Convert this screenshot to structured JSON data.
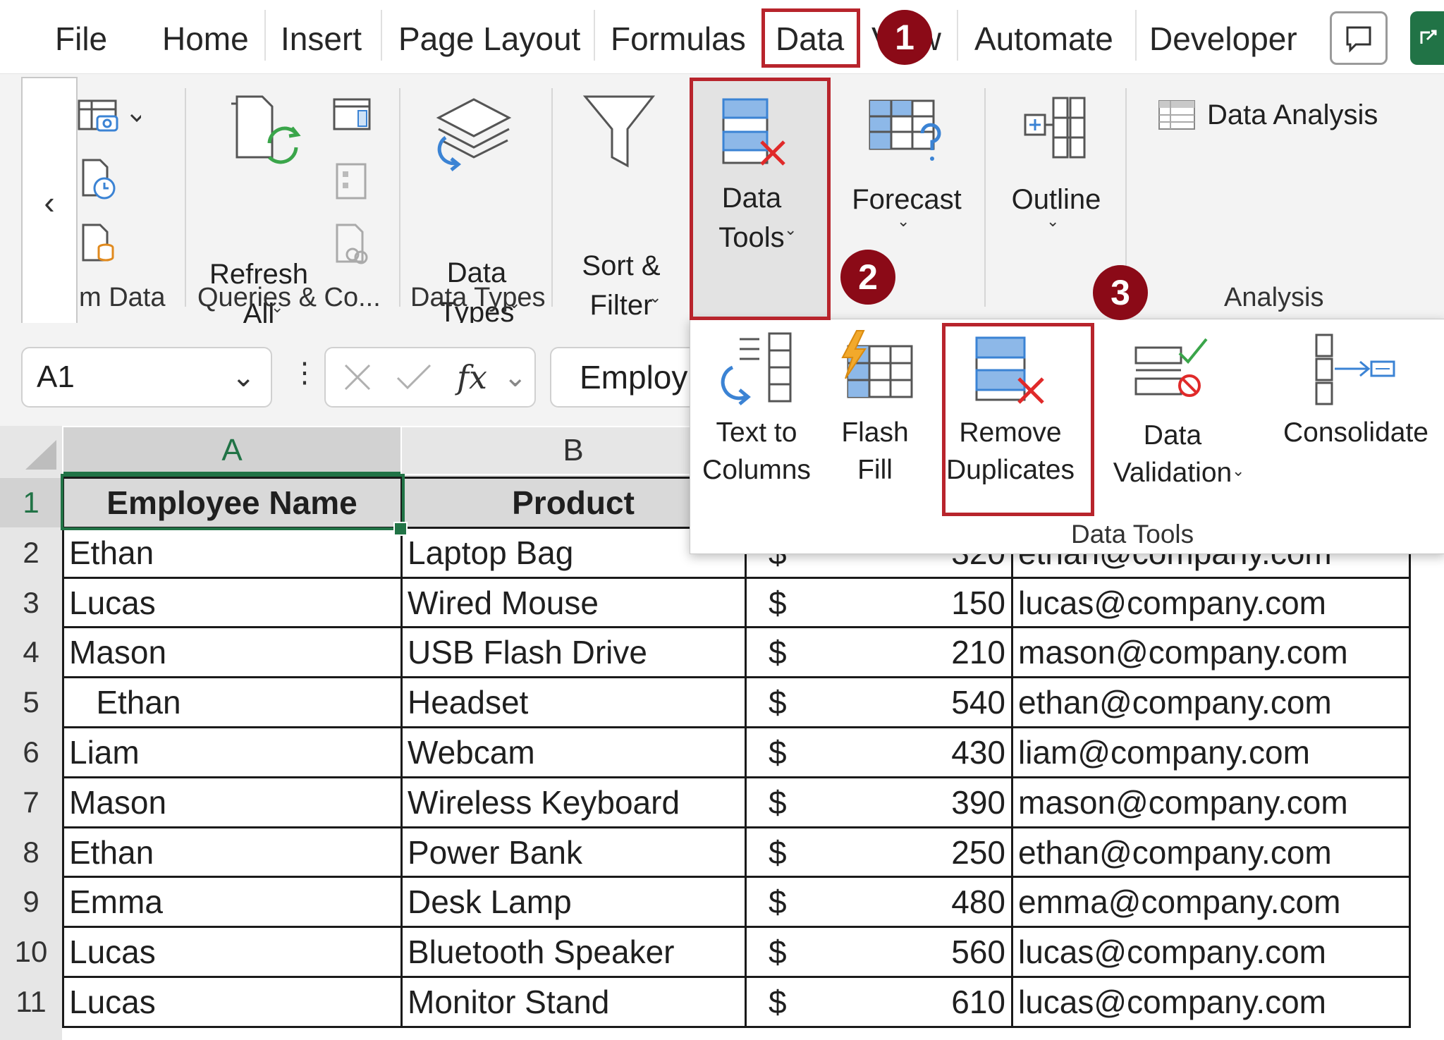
{
  "tabs": [
    "File",
    "Home",
    "Insert",
    "Page Layout",
    "Formulas",
    "Data",
    "View",
    "Automate",
    "Developer"
  ],
  "active_tab": "Data",
  "ribbon": {
    "get_data_group_label": "m Data",
    "refresh_all": "Refresh All",
    "queries_group_label": "Queries & Co...",
    "data_types": "Data Types",
    "data_types_group_label": "Data Types",
    "sort_filter": "Sort & Filter",
    "data_tools": "Data Tools",
    "forecast": "Forecast",
    "outline": "Outline",
    "data_analysis": "Data Analysis",
    "analysis_group_label": "Analysis",
    "collapse_arrow": "‹"
  },
  "dropdown": {
    "items": [
      "Text to Columns",
      "Flash Fill",
      "Remove Duplicates",
      "Data Validation",
      "Consolidate"
    ],
    "group_label": "Data Tools"
  },
  "formula_bar": {
    "name_box": "A1",
    "fx": "fx",
    "content": "Employ"
  },
  "markers": [
    "1",
    "2",
    "3"
  ],
  "columns": [
    "A",
    "B"
  ],
  "table": {
    "headers": [
      "Employee Name",
      "Product"
    ],
    "rows": [
      {
        "num": "1"
      },
      {
        "num": "2",
        "name": "Ethan",
        "product": "Laptop Bag",
        "cur": "$",
        "amount": "320",
        "email": "ethan@company.com"
      },
      {
        "num": "3",
        "name": "Lucas",
        "product": "Wired Mouse",
        "cur": "$",
        "amount": "150",
        "email": "lucas@company.com"
      },
      {
        "num": "4",
        "name": "Mason",
        "product": "USB Flash Drive",
        "cur": "$",
        "amount": "210",
        "email": "mason@company.com"
      },
      {
        "num": "5",
        "name": "   Ethan",
        "product": "Headset",
        "cur": "$",
        "amount": "540",
        "email": "ethan@company.com"
      },
      {
        "num": "6",
        "name": "Liam",
        "product": "Webcam",
        "cur": "$",
        "amount": "430",
        "email": "liam@company.com"
      },
      {
        "num": "7",
        "name": "Mason",
        "product": "Wireless Keyboard",
        "cur": "$",
        "amount": "390",
        "email": "mason@company.com"
      },
      {
        "num": "8",
        "name": "Ethan",
        "product": "Power Bank",
        "cur": "$",
        "amount": "250",
        "email": "ethan@company.com"
      },
      {
        "num": "9",
        "name": "Emma",
        "product": "Desk Lamp",
        "cur": "$",
        "amount": "480",
        "email": "emma@company.com"
      },
      {
        "num": "10",
        "name": "Lucas",
        "product": "Bluetooth Speaker",
        "cur": "$",
        "amount": "560",
        "email": "lucas@company.com"
      },
      {
        "num": "11",
        "name": "Lucas",
        "product": "Monitor Stand",
        "cur": "$",
        "amount": "610",
        "email": "lucas@company.com"
      }
    ]
  },
  "colors": {
    "highlight": "#b8242c",
    "marker": "#8b0a17",
    "selection": "#217346",
    "icon_blue": "#3b83d4"
  }
}
